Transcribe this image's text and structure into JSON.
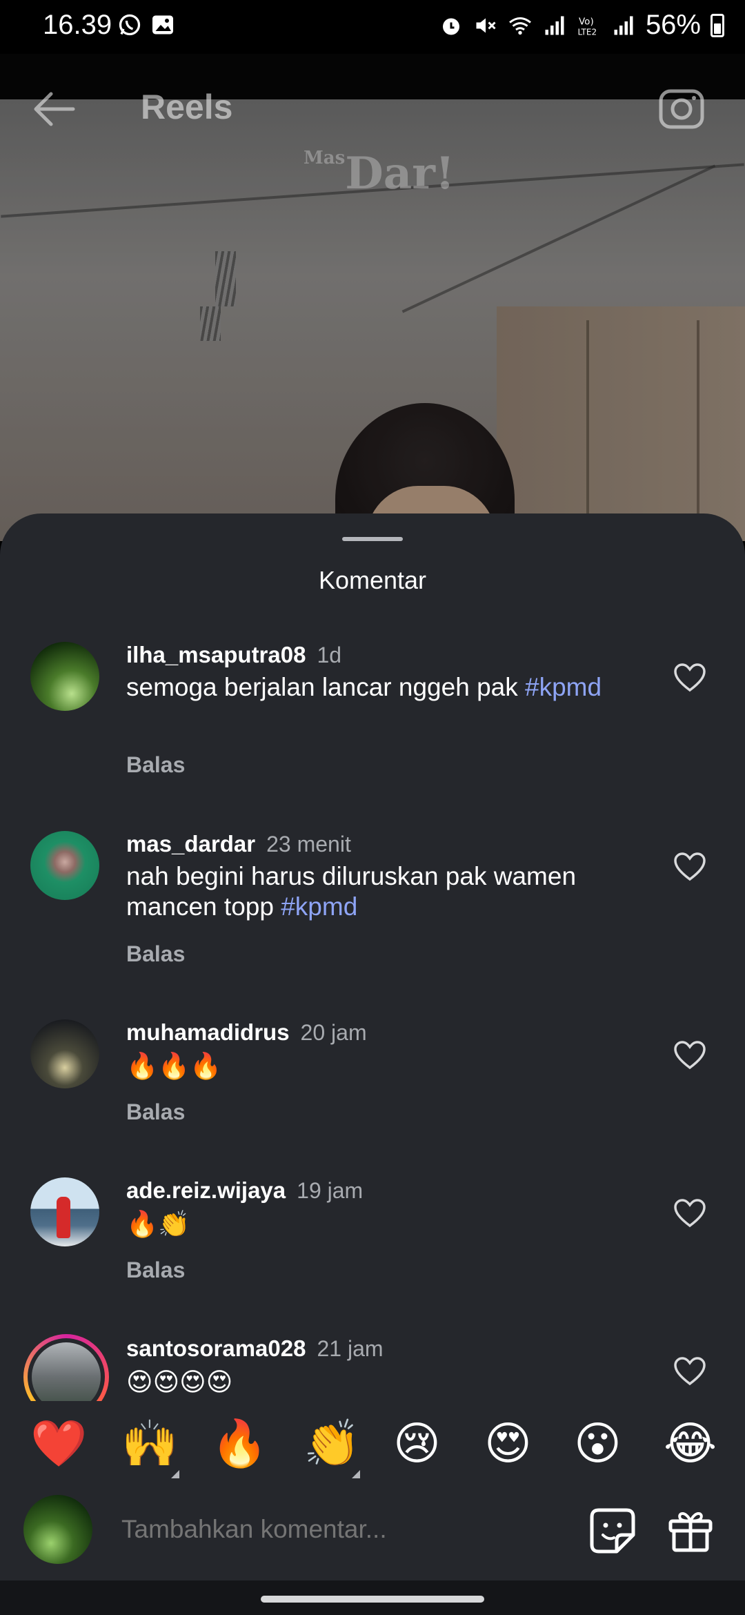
{
  "status_bar": {
    "time": "16.39",
    "battery": "56%",
    "left_icons": [
      "whatsapp-icon",
      "gallery-icon"
    ],
    "right_icons": [
      "alarm-icon",
      "mute-icon",
      "wifi-icon",
      "signal-icon",
      "volte-icon",
      "signal-icon",
      "battery-icon"
    ]
  },
  "header": {
    "title": "Reels",
    "back_icon": "arrow-left-icon",
    "camera_icon": "camera-icon"
  },
  "video": {
    "watermark": "Dar!",
    "watermark_prefix": "Mas"
  },
  "sheet": {
    "title": "Komentar",
    "comments": [
      {
        "user": "ilha_msaputra08",
        "time": "1d",
        "text": "semoga berjalan lancar nggeh pak",
        "tag": "#kpmd",
        "reply": "Balas"
      },
      {
        "user": "mas_dardar",
        "time": "23 menit",
        "text": "nah begini harus diluruskan pak wamen mancen topp",
        "tag": "#kpmd",
        "reply": "Balas"
      },
      {
        "user": "muhamadidrus",
        "time": "20 jam",
        "text": "🔥🔥🔥",
        "tag": "",
        "reply": "Balas"
      },
      {
        "user": "ade.reiz.wijaya",
        "time": "19 jam",
        "text": "🔥👏",
        "tag": "",
        "reply": "Balas"
      },
      {
        "user": "santosorama028",
        "time": "21 jam",
        "text": "😍😍😍😍",
        "tag": "",
        "reply": ""
      }
    ]
  },
  "emoji_bar": [
    "❤️",
    "🙌",
    "🔥",
    "👏",
    "😢",
    "😍",
    "😮",
    "😂"
  ],
  "input": {
    "placeholder": "Tambahkan komentar...",
    "sticker_icon": "sticker-icon",
    "gift_icon": "gift-icon"
  },
  "colors": {
    "sheet_bg": "#25272c",
    "hashtag": "#8ea4f5",
    "muted": "#a8abb0"
  }
}
